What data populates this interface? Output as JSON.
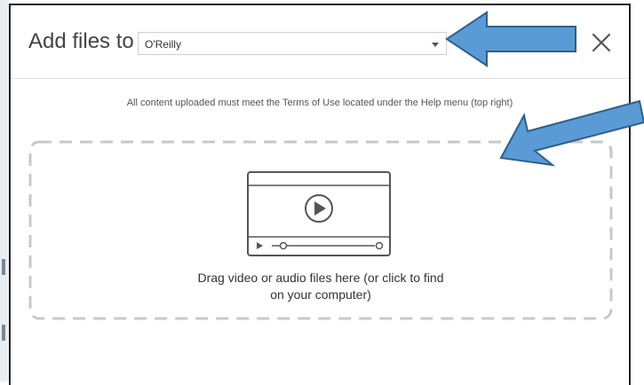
{
  "dialog": {
    "title": "Add files to",
    "destination": {
      "selected": "O'Reilly"
    },
    "close_icon": "close-icon",
    "notice": "All content uploaded must meet the Terms of Use located under the Help menu (top right)",
    "dropzone": {
      "icon": "video-player-icon",
      "text_line1": "Drag video or audio files here (or click to find",
      "text_line2": "on your computer)"
    }
  },
  "annotations": [
    {
      "icon": "blue-arrow-left",
      "color": "#5b9bd5"
    },
    {
      "icon": "blue-arrow-down-left",
      "color": "#5b9bd5"
    }
  ]
}
